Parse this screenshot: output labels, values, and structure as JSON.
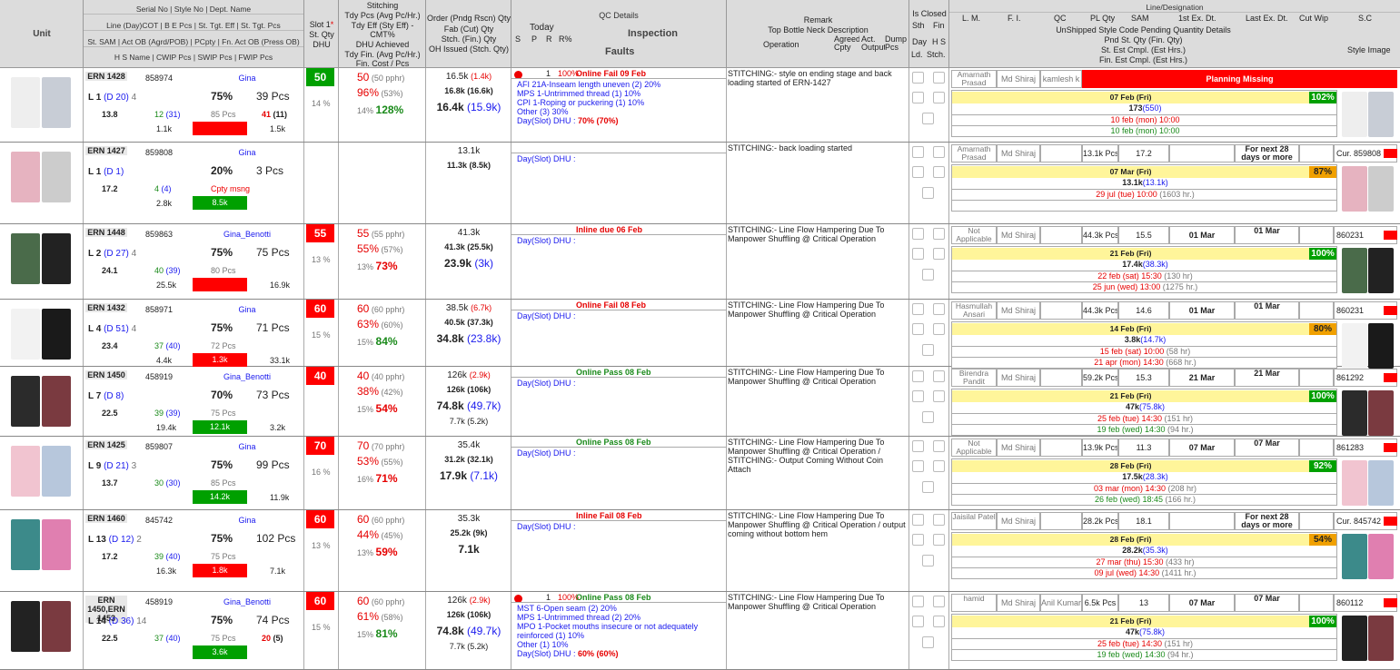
{
  "header": {
    "unit": "Unit",
    "serial_line": "Serial No | Style No | Dept. Name",
    "line_day": "Line (Day)COT | B E Pcs | St. Tgt. Eff | St. Tgt. Pcs",
    "st_sam": "St. SAM | Act OB (Agrd/POB) | PCpty | Fn. Act OB (Press OB)",
    "hs_name": "H S Name | CWIP Pcs | SWIP Pcs | FWIP Pcs",
    "slot": "Slot 1",
    "slot_star": "*",
    "st_qty": "St. Qty",
    "dhu": "DHU",
    "stitching": "Stitching",
    "tdy_pcs": "Tdy Pcs (Avg Pc/Hr.)",
    "tdy_eff": "Tdy Eff (Sty Eff) -",
    "cmt": "CMT%",
    "dhu_ach": "DHU Achieved",
    "tdy_fin": "Tdy Fin. (Avg Pc/Hr.)",
    "fin_cost": "Fin. Cost / Pcs",
    "order_qty": "Order (Pndg Rscn) Qty",
    "fab_qty": "Fab (Cut) Qty",
    "stch_qty": "Stch. (Fin.) Qty",
    "oh_issued": "OH Issued (Stch. Qty)",
    "qc_details": "QC Details",
    "today": "Today",
    "inspection": "Inspection",
    "s": "S",
    "p": "P",
    "r": "R",
    "rpct": "R%",
    "faults": "Faults",
    "remark": "Remark",
    "top_bottle": "Top Bottle Neck Description",
    "operation": "Operation",
    "agreed_cpty": "Agreed Cpty",
    "act_output": "Act. Output",
    "dump_pcs": "Dump Pcs",
    "is_closed": "Is Closed",
    "sth": "Sth",
    "fin": "Fin",
    "day": "Day",
    "hs": "H S",
    "ld": "Ld.",
    "stch": "Stch.",
    "line_desig": "Line/Designation",
    "lm": "L. M.",
    "fi": "F. I.",
    "qc": "QC",
    "pl_qty": "PL Qty",
    "sam": "SAM",
    "first_ex": "1st Ex. Dt.",
    "last_ex": "Last Ex. Dt.",
    "cut_wip": "Cut Wip",
    "sc": "S.C",
    "unshipped": "UnShipped Style Code Pending Quantity Details",
    "pnd_st": "Pnd St. Qty (Fin. Qty)",
    "st_est": "St. Est Cmpl. (Est Hrs.)",
    "fin_est": "Fin. Est Cmpl. (Est Hrs.)",
    "style_image": "Style Image"
  },
  "colors": {
    "red": "#ff0000",
    "green": "#00a000",
    "orange": "#f0a000",
    "yellow": "#fff59a",
    "header": "#dcdcdc"
  },
  "rows": [
    {
      "ern": "ERN 1428",
      "style": "858974",
      "dept": "Gina",
      "line": "L 1",
      "cot": "(D 20)",
      "be": "4",
      "eff": "75%",
      "tgt": "39 Pcs",
      "sam": "13.8",
      "ob": "12",
      "obp": "(31)",
      "pcpty": "85 Pcs",
      "fnob": "41",
      "fnobp": "(11)",
      "cwip": "1.1k",
      "swip": "",
      "swip_color": "red",
      "fwip": "1.5k",
      "slot": "50",
      "slot_color": "green",
      "dhu": "14 %",
      "tdy": "50",
      "tdy_avg": "(50 pphr)",
      "teff": "96%",
      "teff_s": "(53%)",
      "cmt": "14%",
      "cmt_v": "128%",
      "order": "16.5k",
      "order_p": "(1.4k)",
      "fab": "16.8k",
      "fab_c": "(16.6k)",
      "stch": "16.4k",
      "stch_f": "(15.9k)",
      "oh": "",
      "qc_dot": "red",
      "qc_s": "1",
      "qc_pct": "100%",
      "qc_status": "Online Fail 09 Feb",
      "qc_class": "red",
      "faults": [
        "AFI 21A-Inseam length uneven (2) 20%",
        "MPS 1-Untrimmed thread (1) 10%",
        "CPI 1-Roping or puckering (1) 10%",
        "Other (3) 30%",
        "Day(Slot) DHU : 70% (70%)"
      ],
      "remark": "STITCHING:- style on ending stage and back loading started of ERN-1427",
      "lm": "Amarnath Prasad",
      "fi": "Md Shiraj",
      "qcn": "kamlesh k",
      "plq": "",
      "samv": "",
      "fex": "",
      "lex": "",
      "planning": "Planning Missing",
      "sc": "",
      "ribbon": "07 Feb (Fri)",
      "pctv": "102%",
      "pct_color": "green",
      "pnd": "173",
      "pnd_f": "(550)",
      "st_est": "10 feb (mon) 10:00",
      "st_est_h": "",
      "fin_est": "10 feb (mon) 10:00",
      "fin_est_h": "",
      "img": [
        "#eee",
        "#c8cdd6"
      ]
    },
    {
      "ern": "ERN 1427",
      "style": "859808",
      "dept": "Gina",
      "line": "L 1",
      "cot": "(D 1)",
      "be": "",
      "eff": "20%",
      "tgt": "3 Pcs",
      "sam": "17.2",
      "ob": "4",
      "obp": "(4)",
      "pcpty": "Cpty msng",
      "fnob": "",
      "fnobp": "",
      "cwip": "2.8k",
      "swip": "8.5k",
      "swip_color": "green",
      "fwip": "",
      "slot": "",
      "slot_color": "",
      "dhu": "",
      "tdy": "",
      "tdy_avg": "",
      "teff": "",
      "teff_s": "",
      "cmt": "",
      "cmt_v": "",
      "order": "13.1k",
      "order_p": "",
      "fab": "11.3k",
      "fab_c": "(8.5k)",
      "stch": "",
      "stch_f": "",
      "oh": "",
      "qc_dot": "",
      "qc_s": "",
      "qc_pct": "",
      "qc_status": "",
      "qc_class": "",
      "faults": [
        "Day(Slot) DHU :"
      ],
      "remark": "STITCHING:- back loading started",
      "lm": "Amarnath Prasad",
      "fi": "Md Shiraj",
      "qcn": "",
      "plq": "13.1k Pcs",
      "samv": "17.2",
      "fex": "",
      "lex": "For next 28 days or more",
      "planning": "",
      "sc": "Cur. 859808",
      "ribbon": "07 Mar (Fri)",
      "pctv": "87%",
      "pct_color": "orange",
      "pnd": "13.1k",
      "pnd_f": "(13.1k)",
      "st_est": "29 jul (tue) 10:00",
      "st_est_h": "(1603 hr.)",
      "fin_est": "",
      "fin_est_h": "",
      "img": [
        "#e6b3c0",
        "#ccc"
      ]
    },
    {
      "ern": "ERN 1448",
      "style": "859863",
      "dept": "Gina_Benotti",
      "line": "L 2",
      "cot": "(D 27)",
      "be": "4",
      "eff": "75%",
      "tgt": "75 Pcs",
      "sam": "24.1",
      "ob": "40",
      "obp": "(39)",
      "pcpty": "80 Pcs",
      "fnob": "",
      "fnobp": "",
      "cwip": "25.5k",
      "swip": "",
      "swip_color": "red",
      "fwip": "16.9k",
      "slot": "55",
      "slot_color": "red",
      "dhu": "13 %",
      "tdy": "55",
      "tdy_avg": "(55 pphr)",
      "teff": "55%",
      "teff_s": "(57%)",
      "cmt": "13%",
      "cmt_v": "73%",
      "order": "41.3k",
      "order_p": "",
      "fab": "41.3k",
      "fab_c": "(25.5k)",
      "stch": "23.9k",
      "stch_f": "(3k)",
      "oh": "",
      "qc_dot": "",
      "qc_s": "",
      "qc_pct": "",
      "qc_status": "Inline due 06 Feb",
      "qc_class": "red",
      "faults": [
        "Day(Slot) DHU :"
      ],
      "remark": "STITCHING:- Line Flow Hampering Due To Manpower Shuffling @ Critical Operation",
      "lm": "Not Applicable C47 L2",
      "fi": "Md Shiraj",
      "qcn": "",
      "plq": "44.3k Pcs",
      "samv": "15.5",
      "fex": "01 Mar",
      "lex": "01 Mar",
      "planning": "",
      "sc": "860231",
      "ribbon": "21 Feb (Fri)",
      "pctv": "100%",
      "pct_color": "green",
      "pnd": "17.4k",
      "pnd_f": "(38.3k)",
      "st_est": "22 feb (sat) 15:30",
      "st_est_h": "(130 hr)",
      "fin_est": "25 jun (wed) 13:00",
      "fin_est_h": "(1275 hr.)",
      "img": [
        "#4a6b4a",
        "#222"
      ]
    },
    {
      "ern": "ERN 1432",
      "style": "858971",
      "dept": "Gina",
      "line": "L 4",
      "cot": "(D 51)",
      "be": "4",
      "eff": "75%",
      "tgt": "71 Pcs",
      "sam": "23.4",
      "ob": "37",
      "obp": "(40)",
      "pcpty": "72 Pcs",
      "fnob": "",
      "fnobp": "",
      "cwip": "4.4k",
      "swip": "1.3k",
      "swip_color": "red",
      "fwip": "33.1k",
      "slot": "60",
      "slot_color": "red",
      "dhu": "15 %",
      "tdy": "60",
      "tdy_avg": "(60 pphr)",
      "teff": "63%",
      "teff_s": "(60%)",
      "cmt": "15%",
      "cmt_v": "84%",
      "order": "38.5k",
      "order_p": "(6.7k)",
      "fab": "40.5k",
      "fab_c": "(37.3k)",
      "stch": "34.8k",
      "stch_f": "(23.8k)",
      "oh": "",
      "qc_dot": "",
      "qc_s": "",
      "qc_pct": "",
      "qc_status": "Online Fail 08 Feb",
      "qc_class": "red",
      "faults": [
        "Day(Slot) DHU :"
      ],
      "remark": "STITCHING:- Line Flow Hampering Due To Manpower Shuffling @ Critical Operation",
      "lm": "Hasmullah Ansari",
      "fi": "Md Shiraj",
      "qcn": "",
      "plq": "44.3k Pcs",
      "samv": "14.6",
      "fex": "01 Mar",
      "lex": "01 Mar",
      "planning": "",
      "sc": "860231",
      "ribbon": "14 Feb (Fri)",
      "pctv": "80%",
      "pct_color": "orange",
      "pnd": "3.8k",
      "pnd_f": "(14.7k)",
      "st_est": "15 feb (sat) 10:00",
      "st_est_h": "(58 hr)",
      "fin_est": "21 apr (mon) 14:30",
      "fin_est_h": "(668 hr.)",
      "img": [
        "#f2f2f2",
        "#1a1a1a"
      ]
    },
    {
      "ern": "ERN 1450",
      "style": "458919",
      "dept": "Gina_Benotti",
      "line": "L 7",
      "cot": "(D 8)",
      "be": "",
      "eff": "70%",
      "tgt": "73 Pcs",
      "sam": "22.5",
      "ob": "39",
      "obp": "(39)",
      "pcpty": "75 Pcs",
      "fnob": "",
      "fnobp": "",
      "cwip": "19.4k",
      "swip": "12.1k",
      "swip_color": "green",
      "fwip": "3.2k",
      "slot": "40",
      "slot_color": "red",
      "dhu": "",
      "tdy": "40",
      "tdy_avg": "(40 pphr)",
      "teff": "38%",
      "teff_s": "(42%)",
      "cmt": "15%",
      "cmt_v": "54%",
      "order": "126k",
      "order_p": "(2.9k)",
      "fab": "126k",
      "fab_c": "(106k)",
      "stch": "74.8k",
      "stch_f": "(49.7k)",
      "oh": "7.7k",
      "oh_s": "(5.2k)",
      "qc_dot": "",
      "qc_s": "",
      "qc_pct": "",
      "qc_status": "Online Pass 08 Feb",
      "qc_class": "grn",
      "faults": [
        "Day(Slot) DHU :"
      ],
      "remark": "STITCHING:- Line Flow Hampering Due To Manpower Shuffling @ Critical Operation",
      "lm": "Birendra Pandit",
      "fi": "Md Shiraj",
      "qcn": "",
      "plq": "59.2k Pcs",
      "samv": "15.3",
      "fex": "21 Mar",
      "lex": "21 Mar",
      "planning": "",
      "sc": "861292",
      "ribbon": "21 Feb (Fri)",
      "pctv": "100%",
      "pct_color": "green",
      "pnd": "47k",
      "pnd_f": "(75.8k)",
      "st_est": "25 feb (tue) 14:30",
      "st_est_h": "(151 hr)",
      "fin_est": "19 feb (wed) 14:30",
      "fin_est_h": "(94 hr.)",
      "img": [
        "#2b2b2b",
        "#7a3a40"
      ]
    },
    {
      "ern": "ERN 1425",
      "style": "859807",
      "dept": "Gina",
      "line": "L 9",
      "cot": "(D 21)",
      "be": "3",
      "eff": "75%",
      "tgt": "99 Pcs",
      "sam": "13.7",
      "ob": "30",
      "obp": "(30)",
      "pcpty": "85 Pcs",
      "fnob": "",
      "fnobp": "",
      "cwip": "",
      "swip": "14.2k",
      "swip_color": "green",
      "fwip": "11.9k",
      "slot": "70",
      "slot_color": "red",
      "dhu": "16 %",
      "tdy": "70",
      "tdy_avg": "(70 pphr)",
      "teff": "53%",
      "teff_s": "(55%)",
      "cmt": "16%",
      "cmt_v": "71%",
      "order": "35.4k",
      "order_p": "",
      "fab": "31.2k",
      "fab_c": "(32.1k)",
      "stch": "17.9k",
      "stch_f": "(7.1k)",
      "oh": "",
      "qc_dot": "",
      "qc_s": "",
      "qc_pct": "",
      "qc_status": "Online Pass 08 Feb",
      "qc_class": "grn",
      "faults": [
        "Day(Slot) DHU :"
      ],
      "remark": "STITCHING:- Line Flow Hampering Due To Manpower Shuffling @ Critical Operation / STITCHING:- Output Coming Without Coin Attach",
      "lm": "Not Applicable C47 L9",
      "fi": "Md Shiraj",
      "qcn": "",
      "plq": "13.9k Pcs",
      "samv": "11.3",
      "fex": "07 Mar",
      "lex": "07 Mar",
      "planning": "",
      "sc": "861283",
      "ribbon": "28 Feb (Fri)",
      "pctv": "92%",
      "pct_color": "green",
      "pnd": "17.5k",
      "pnd_f": "(28.3k)",
      "st_est": "03 mar (mon) 14:30",
      "st_est_h": "(208 hr)",
      "fin_est": "26 feb (wed) 18:45",
      "fin_est_h": "(166 hr.)",
      "img": [
        "#f1c4d0",
        "#b7c7dc"
      ]
    },
    {
      "ern": "ERN 1460",
      "style": "845742",
      "dept": "Gina",
      "line": "L 13",
      "cot": "(D 12)",
      "be": "2",
      "eff": "75%",
      "tgt": "102 Pcs",
      "sam": "17.2",
      "ob": "39",
      "obp": "(40)",
      "pcpty": "75 Pcs",
      "fnob": "",
      "fnobp": "",
      "cwip": "16.3k",
      "swip": "1.8k",
      "swip_color": "red",
      "fwip": "7.1k",
      "slot": "60",
      "slot_color": "red",
      "dhu": "13 %",
      "tdy": "60",
      "tdy_avg": "(60 pphr)",
      "teff": "44%",
      "teff_s": "(45%)",
      "cmt": "13%",
      "cmt_v": "59%",
      "order": "35.3k",
      "order_p": "",
      "fab": "25.2k",
      "fab_c": "(9k)",
      "stch": "7.1k",
      "stch_f": "",
      "oh": "",
      "qc_dot": "",
      "qc_s": "",
      "qc_pct": "",
      "qc_status": "Inline Fail 08 Feb",
      "qc_class": "red",
      "faults": [
        "Day(Slot) DHU :"
      ],
      "remark": "STITCHING:- Line Flow Hampering Due To Manpower Shuffling @ Critical Operation / output coming without bottom hem",
      "lm": "Jaisilal Patel",
      "fi": "Md Shiraj",
      "qcn": "",
      "plq": "28.2k Pcs",
      "samv": "18.1",
      "fex": "",
      "lex": "For next 28 days or more",
      "planning": "",
      "sc": "Cur. 845742",
      "ribbon": "28 Feb (Fri)",
      "pctv": "54%",
      "pct_color": "orange",
      "pnd": "28.2k",
      "pnd_f": "(35.3k)",
      "st_est": "27 mar (thu) 15:30",
      "st_est_h": "(433 hr)",
      "fin_est": "09 jul (wed) 14:30",
      "fin_est_h": "(1411 hr.)",
      "img": [
        "#3c8a8a",
        "#e07fb0"
      ]
    },
    {
      "ern": "ERN 1450,ERN 1453",
      "style": "458919",
      "dept": "Gina_Benotti",
      "line": "L 14",
      "cot": "(D 36)",
      "be": "14",
      "eff": "75%",
      "tgt": "74 Pcs",
      "sam": "22.5",
      "ob": "37",
      "obp": "(40)",
      "pcpty": "75 Pcs",
      "fnob": "20",
      "fnobp": "(5)",
      "cwip": "",
      "swip": "3.6k",
      "swip_color": "green",
      "fwip": "",
      "slot": "60",
      "slot_color": "red",
      "dhu": "15 %",
      "tdy": "60",
      "tdy_avg": "(60 pphr)",
      "teff": "61%",
      "teff_s": "(58%)",
      "cmt": "15%",
      "cmt_v": "81%",
      "order": "126k",
      "order_p": "(2.9k)",
      "fab": "126k",
      "fab_c": "(106k)",
      "stch": "74.8k",
      "stch_f": "(49.7k)",
      "oh": "7.7k",
      "oh_s": "(5.2k)",
      "qc_dot": "red",
      "qc_s": "1",
      "qc_pct": "100%",
      "qc_status": "Online Pass 08 Feb",
      "qc_class": "grn",
      "faults": [
        "MST 6-Open seam (2) 20%",
        "MPS 1-Untrimmed thread (2) 20%",
        "MPO 1-Pocket mouths insecure or not adequately reinforced (1) 10%",
        "Other (1) 10%",
        "Day(Slot) DHU : 60% (60%)"
      ],
      "remark": "STITCHING:- Line Flow Hampering Due To Manpower Shuffling @ Critical Operation",
      "lm": "hamid",
      "fi": "Md Shiraj",
      "qcn": "Anil Kumar",
      "plq": "6.5k Pcs",
      "samv": "13",
      "fex": "07 Mar",
      "lex": "07 Mar",
      "planning": "",
      "sc": "860112",
      "ribbon": "21 Feb (Fri)",
      "pctv": "100%",
      "pct_color": "green",
      "pnd": "47k",
      "pnd_f": "(75.8k)",
      "st_est": "25 feb (tue) 14:30",
      "st_est_h": "(151 hr)",
      "fin_est": "19 feb (wed) 14:30",
      "fin_est_h": "(94 hr.)",
      "img": [
        "#222",
        "#7a3a40"
      ]
    }
  ]
}
